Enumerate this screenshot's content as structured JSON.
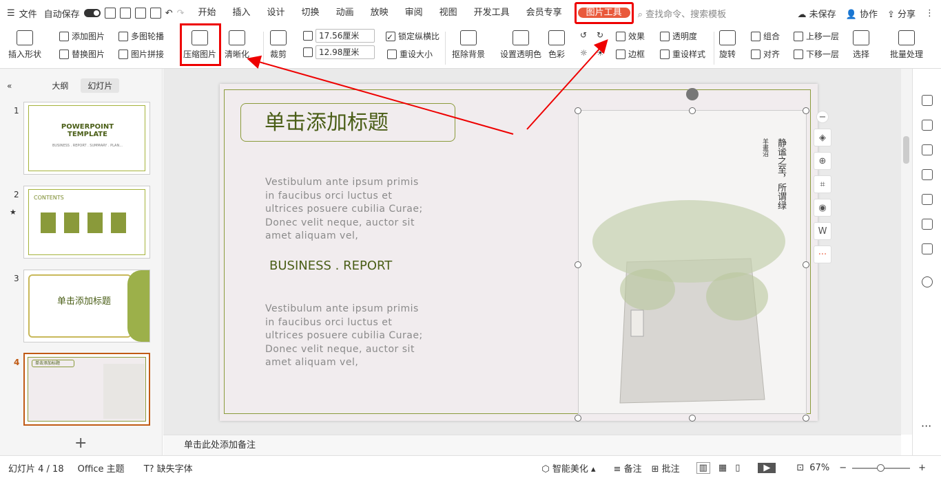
{
  "topbar": {
    "menu": "文件",
    "autosave": "自动保存",
    "tabs": [
      "开始",
      "插入",
      "设计",
      "切换",
      "动画",
      "放映",
      "审阅",
      "视图",
      "开发工具",
      "会员专享"
    ],
    "active_tab": "图片工具",
    "search": "查找命令、搜索模板",
    "unsaved": "未保存",
    "collab": "协作",
    "share": "分享"
  },
  "ribbon": {
    "insert_shape": "插入形状",
    "add_image": "添加图片",
    "carousel": "多图轮播",
    "replace_image": "替换图片",
    "collage": "图片拼接",
    "compress": "压缩图片",
    "sharpen": "清晰化",
    "crop": "裁剪",
    "width": "17.56厘米",
    "height": "12.98厘米",
    "lock_ratio": "锁定纵横比",
    "reset_size": "重设大小",
    "remove_bg": "抠除背景",
    "set_transparent": "设置透明色",
    "color": "色彩",
    "effects": "效果",
    "transparency": "透明度",
    "border": "边框",
    "reset_style": "重设样式",
    "rotate": "旋转",
    "group": "组合",
    "align": "对齐",
    "bring_forward": "上移一层",
    "send_backward": "下移一层",
    "select": "选择",
    "batch": "批量处理"
  },
  "leftpanel": {
    "tab_outline": "大纲",
    "tab_slides": "幻灯片",
    "numbers": [
      "1",
      "2",
      "3",
      "4"
    ],
    "t1_title": "POWERPOINT TEMPLATE",
    "t1_sub": "BUSINESS . REPORT . SUMMARY . PLAN...",
    "t2_title": "CONTENTS",
    "t3_title": "单击添加标题",
    "t4_title": "单击添加标题",
    "add": "+"
  },
  "slide": {
    "title": "单击添加标题",
    "body": "Vestibulum ante ipsum primis in faucibus orci luctus et ultrices posuere cubilia Curae; Donec velit neque, auctor sit amet aliquam vel,",
    "heading": "BUSINESS . REPORT",
    "poem": "静谧之至，所谓绿",
    "author": "羊畫沼"
  },
  "notes": "单击此处添加备注",
  "status": {
    "slide_count": "幻灯片 4 / 18",
    "theme": "Office 主题",
    "missing_font": "缺失字体",
    "beautify": "智能美化",
    "notes": "备注",
    "comment": "批注",
    "zoom": "67%"
  },
  "colors": {
    "accent": "#e9593b",
    "highlight": "#e00000",
    "olive": "#4a5e17"
  }
}
